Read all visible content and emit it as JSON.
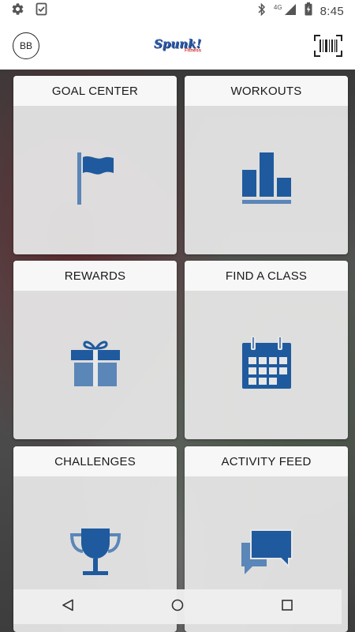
{
  "status_bar": {
    "network_label": "4G",
    "time": "8:45",
    "icons": [
      "gear-icon",
      "clipboard-check-icon",
      "bluetooth-icon",
      "signal-icon",
      "battery-charging-icon"
    ]
  },
  "app_bar": {
    "avatar_initials": "BB",
    "logo_text": "Spunk!",
    "logo_subtext": "Fitness",
    "barcode_icon": "barcode-scan-icon"
  },
  "tiles": [
    {
      "label": "GOAL CENTER",
      "icon": "flag-icon"
    },
    {
      "label": "WORKOUTS",
      "icon": "bar-chart-icon"
    },
    {
      "label": "REWARDS",
      "icon": "gift-icon"
    },
    {
      "label": "FIND A CLASS",
      "icon": "calendar-icon"
    },
    {
      "label": "CHALLENGES",
      "icon": "trophy-icon"
    },
    {
      "label": "ACTIVITY FEED",
      "icon": "chat-bubbles-icon"
    }
  ],
  "nav_bar": {
    "buttons": [
      "back-icon",
      "home-icon",
      "recents-icon"
    ]
  },
  "colors": {
    "brand_blue": "#1f5a9e",
    "icon_light_blue": "#5b86b8",
    "logo_blue": "#2b59a8",
    "logo_red": "#d9342b"
  }
}
